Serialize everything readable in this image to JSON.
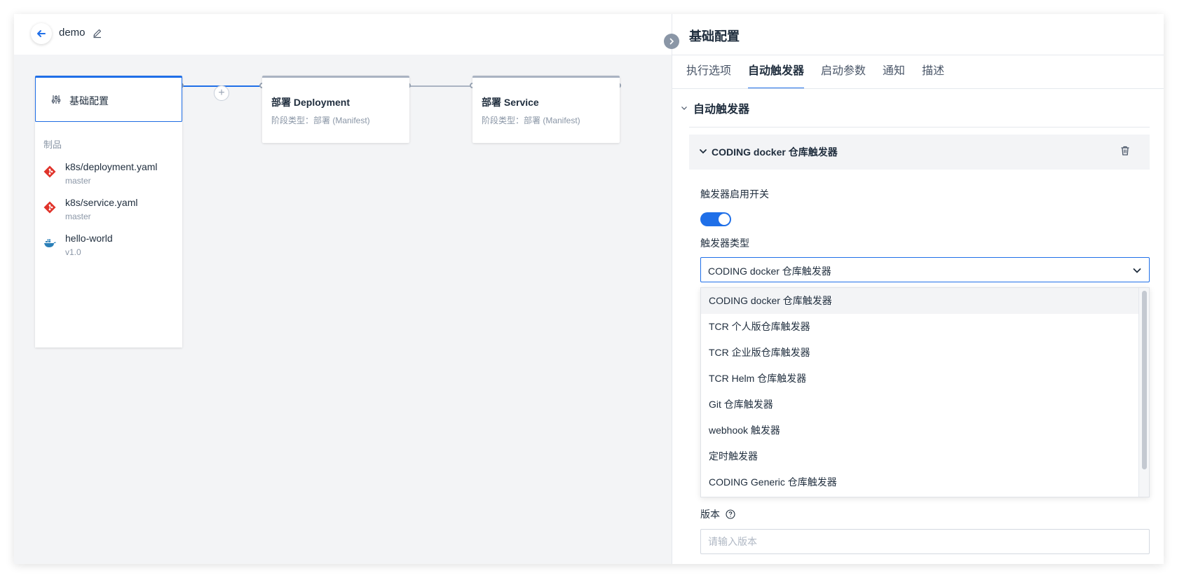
{
  "header": {
    "pipeline_name": "demo"
  },
  "canvas": {
    "first_stage": {
      "label": "基础配置",
      "artifacts_title": "制品",
      "artifacts": [
        {
          "name": "k8s/deployment.yaml",
          "sub": "master",
          "icon": "git-icon"
        },
        {
          "name": "k8s/service.yaml",
          "sub": "master",
          "icon": "git-icon"
        },
        {
          "name": "hello-world",
          "sub": "v1.0",
          "icon": "docker-icon"
        }
      ]
    },
    "stages": [
      {
        "title": "部署 Deployment",
        "sub": "阶段类型：部署 (Manifest)"
      },
      {
        "title": "部署 Service",
        "sub": "阶段类型：部署 (Manifest)"
      }
    ],
    "add_button": "+"
  },
  "panel": {
    "title": "基础配置",
    "tabs": [
      {
        "label": "执行选项",
        "active": false
      },
      {
        "label": "自动触发器",
        "active": true
      },
      {
        "label": "启动参数",
        "active": false
      },
      {
        "label": "通知",
        "active": false
      },
      {
        "label": "描述",
        "active": false
      }
    ],
    "section_title": "自动触发器",
    "trigger": {
      "card_title": "CODING docker 仓库触发器",
      "enable_label": "触发器启用开关",
      "enabled": true,
      "type_label": "触发器类型",
      "type_value": "CODING docker 仓库触发器",
      "options": [
        "CODING docker 仓库触发器",
        "TCR 个人版仓库触发器",
        "TCR 企业版仓库触发器",
        "TCR Helm 仓库触发器",
        "Git 仓库触发器",
        "webhook 触发器",
        "定时触发器",
        "CODING Generic 仓库触发器"
      ],
      "version_label": "版本",
      "version_placeholder": "请输入版本",
      "version_value": ""
    }
  },
  "colors": {
    "accent": "#1f6fe8",
    "git": "#e0332a",
    "docker": "#2a7fb8"
  }
}
